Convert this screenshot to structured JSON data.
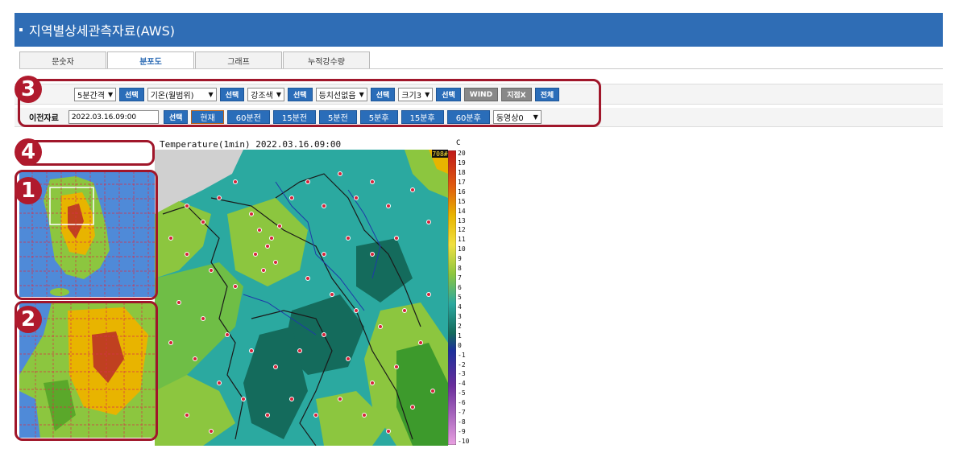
{
  "header": {
    "title": "지역별상세관측자료(AWS)"
  },
  "tabs": [
    {
      "label": "문숫자",
      "active": false
    },
    {
      "label": "분포도",
      "active": true
    },
    {
      "label": "그래프",
      "active": false
    },
    {
      "label": "누적강수량",
      "active": false
    }
  ],
  "controls": {
    "interval": "5분간격",
    "select_label": "선택",
    "element": "기온(월범위)",
    "highlight": "강조색",
    "contour": "등치선없음",
    "size": "크기3",
    "wind": "WIND",
    "station_x": "지점X",
    "all": "전체"
  },
  "time_row": {
    "label": "이전자료",
    "datetime": "2022.03.16.09:00",
    "select_label": "선택",
    "now": "현재",
    "back60": "60분전",
    "back15": "15분전",
    "back5": "5분전",
    "fwd5": "5분후",
    "fwd15": "15분후",
    "fwd60": "60분후",
    "animation": "동영상0"
  },
  "annotations": [
    "1",
    "2",
    "3",
    "4"
  ],
  "map": {
    "title": "Temperature(1min) 2022.03.16.09:00",
    "unit": "C",
    "station_count": "708#",
    "colors": {
      "high": "#e8b400",
      "mid": "#8cc63f",
      "teal": "#2ba9a0",
      "dark": "#146b5c",
      "cold": "#1c2f9b",
      "ocean": "#4f8ad8"
    }
  },
  "legend_ticks": [
    "20",
    "19",
    "18",
    "17",
    "16",
    "15",
    "14",
    "13",
    "12",
    "11",
    "10",
    "9",
    "8",
    "7",
    "6",
    "5",
    "4",
    "3",
    "2",
    "1",
    "0",
    "-1",
    "-2",
    "-3",
    "-4",
    "-5",
    "-6",
    "-7",
    "-8",
    "-9",
    "-10"
  ]
}
